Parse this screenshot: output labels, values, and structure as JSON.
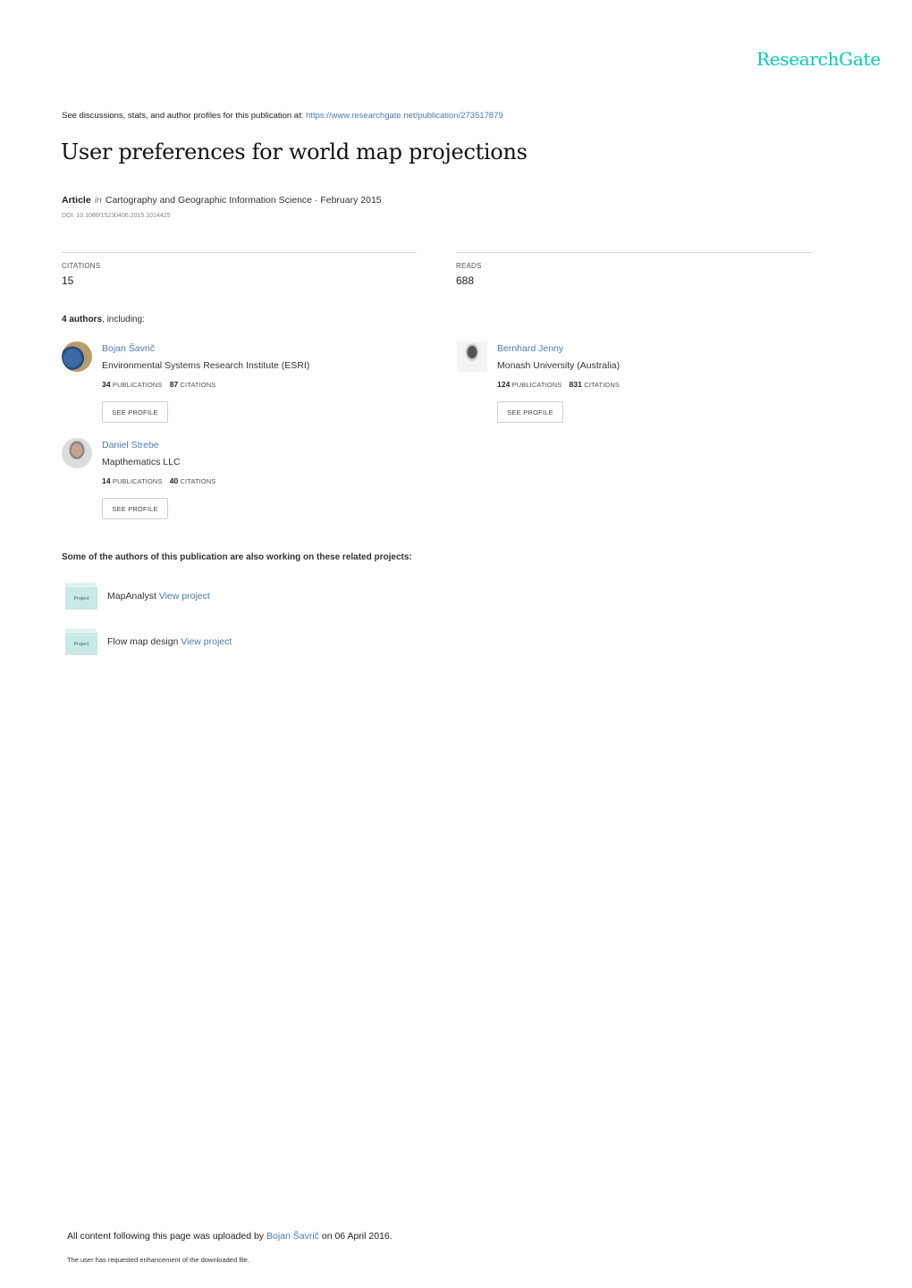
{
  "header": {
    "logo": "ResearchGate",
    "brand_color": "#00ccbb"
  },
  "intro": {
    "text": "See discussions, stats, and author profiles for this publication at: ",
    "url": "https://www.researchgate.net/publication/273517879"
  },
  "publication": {
    "title": "User preferences for world map projections",
    "type": "Article",
    "in_label": "in",
    "journal_date": "Cartography and Geographic Information Science · February 2015",
    "doi": "DOI: 10.1080/15230406.2015.1014425"
  },
  "stats": {
    "citations_label": "CITATIONS",
    "citations_value": "15",
    "reads_label": "READS",
    "reads_value": "688"
  },
  "authors_section": {
    "count_label": "4 authors",
    "suffix": ", including:",
    "authors": [
      {
        "name": "Bojan Šavrič",
        "affiliation": "Environmental Systems Research Institute (ESRI)",
        "publications": "34",
        "publications_label": "PUBLICATIONS",
        "citations": "87",
        "citations_label": "CITATIONS",
        "button": "SEE PROFILE"
      },
      {
        "name": "Bernhard Jenny",
        "affiliation": "Monash University (Australia)",
        "publications": "124",
        "publications_label": "PUBLICATIONS",
        "citations": "831",
        "citations_label": "CITATIONS",
        "button": "SEE PROFILE"
      },
      {
        "name": "Daniel Strebe",
        "affiliation": "Mapthematics LLC",
        "publications": "14",
        "publications_label": "PUBLICATIONS",
        "citations": "40",
        "citations_label": "CITATIONS",
        "button": "SEE PROFILE"
      }
    ]
  },
  "projects_section": {
    "heading": "Some of the authors of this publication are also working on these related projects:",
    "projects": [
      {
        "icon_label": "Project",
        "name": "MapAnalyst",
        "link": "View project"
      },
      {
        "icon_label": "Project",
        "name": "Flow map design",
        "link": "View project"
      }
    ]
  },
  "footer": {
    "upload_prefix": "All content following this page was uploaded by ",
    "uploader": "Bojan Šavrič",
    "upload_suffix": " on 06 April 2016.",
    "note": "The user has requested enhancement of the downloaded file."
  }
}
